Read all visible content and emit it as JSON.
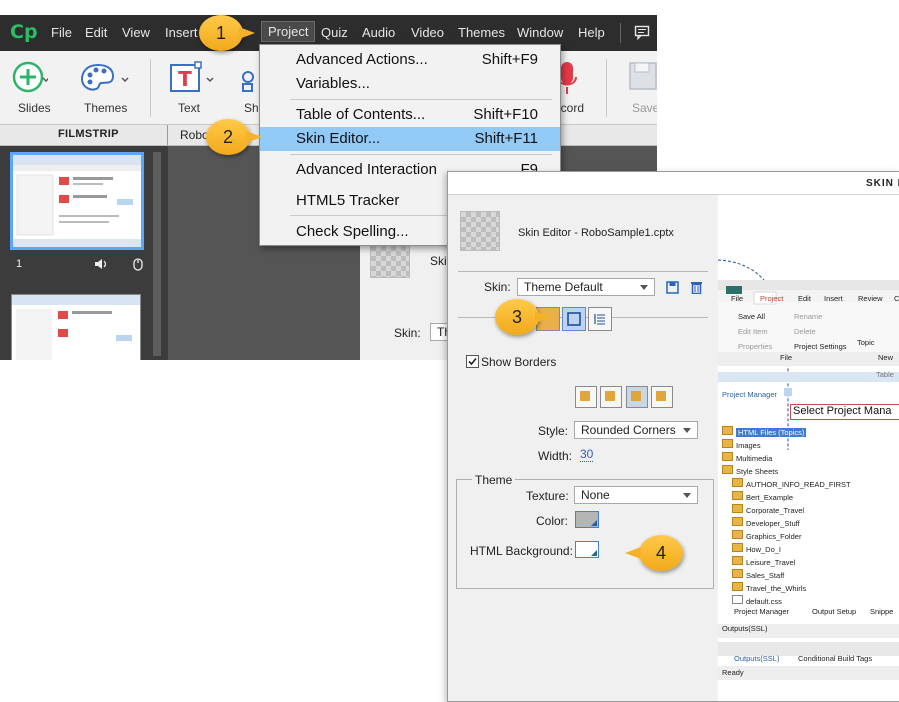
{
  "captivate": {
    "logo": "Cp",
    "menubar": {
      "items": [
        "File",
        "Edit",
        "View",
        "Insert",
        "Project",
        "Quiz",
        "Audio",
        "Video",
        "Themes",
        "Window",
        "Help"
      ],
      "active": "Project"
    },
    "toolbar": {
      "slides_label": "Slides",
      "themes_label": "Themes",
      "text_label": "Text",
      "shapes_label": "Sha",
      "record_label": "ecord",
      "save_label": "Save"
    },
    "panels": {
      "filmstrip_title": "FILMSTRIP",
      "stage_tab": "Robo"
    },
    "filmstrip": {
      "slide_number": "1"
    },
    "stage": {
      "skin_label": "Skin:",
      "skin_value": "Th",
      "partial_text": "Ski"
    }
  },
  "project_menu": {
    "items": [
      {
        "label": "Advanced Actions...",
        "shortcut": "Shift+F9"
      },
      {
        "label": "Variables...",
        "shortcut": ""
      },
      {
        "label": "Table of Contents...",
        "shortcut": "Shift+F10"
      },
      {
        "label": "Skin Editor...",
        "shortcut": "Shift+F11",
        "highlighted": true
      },
      {
        "label": "Advanced Interaction",
        "shortcut": "F9"
      },
      {
        "label": "HTML5 Tracker",
        "shortcut": ""
      },
      {
        "label": "Check Spelling...",
        "shortcut": ""
      }
    ]
  },
  "skin_editor": {
    "window_title": "SKIN E",
    "doc_title": "Skin Editor - RoboSample1.cptx",
    "skin_label": "Skin:",
    "skin_value": "Theme Default",
    "show_borders_label": "Show Borders",
    "show_borders_checked": true,
    "style_label": "Style:",
    "style_value": "Rounded Corners",
    "width_label": "Width:",
    "width_value": "30",
    "theme_group_label": "Theme",
    "texture_label": "Texture:",
    "texture_value": "None",
    "color_label": "Color:",
    "html_bg_label": "HTML Background:"
  },
  "robohelp_preview": {
    "tabs": [
      "File",
      "Project",
      "Edit",
      "Insert",
      "Review",
      "C"
    ],
    "ribbon": {
      "save_all": "Save All",
      "rename": "Rename",
      "edit_item": "Edit Item",
      "delete": "Delete",
      "properties": "Properties",
      "project_settings": "Project Settings",
      "file_group": "File",
      "topic": "Topic",
      "new_group": "New"
    },
    "toolbar_text": "Table",
    "pane_title": "Project Manager",
    "tooltip": "Select Project Mana",
    "tree": [
      {
        "label": "HTML Files (Topics)",
        "level": 0,
        "selected": true
      },
      {
        "label": "Images",
        "level": 0
      },
      {
        "label": "Multimedia",
        "level": 0
      },
      {
        "label": "Style Sheets",
        "level": 0
      },
      {
        "label": "AUTHOR_INFO_READ_FIRST",
        "level": 1
      },
      {
        "label": "Bert_Example",
        "level": 1
      },
      {
        "label": "Corporate_Travel",
        "level": 1
      },
      {
        "label": "Developer_Stuff",
        "level": 1
      },
      {
        "label": "Graphics_Folder",
        "level": 1
      },
      {
        "label": "How_Do_I",
        "level": 1
      },
      {
        "label": "Leisure_Travel",
        "level": 1
      },
      {
        "label": "Sales_Staff",
        "level": 1
      },
      {
        "label": "Travel_the_Whirls",
        "level": 1
      },
      {
        "label": "default.css",
        "level": 1
      }
    ],
    "bottom_tabs": [
      "Project Manager",
      "Output Setup",
      "Snippe"
    ],
    "outputs_label": "Outputs(SSL)",
    "bottom_tabs2": [
      "Outputs(SSL)",
      "Conditional Build Tags"
    ],
    "status": "Ready"
  },
  "callouts": [
    "1",
    "2",
    "3",
    "4"
  ],
  "colors": {
    "menubar_bg": "#2d2d2d",
    "highlight": "#91c9f7",
    "callout": "#f5b128",
    "logo": "#2dbb66"
  }
}
